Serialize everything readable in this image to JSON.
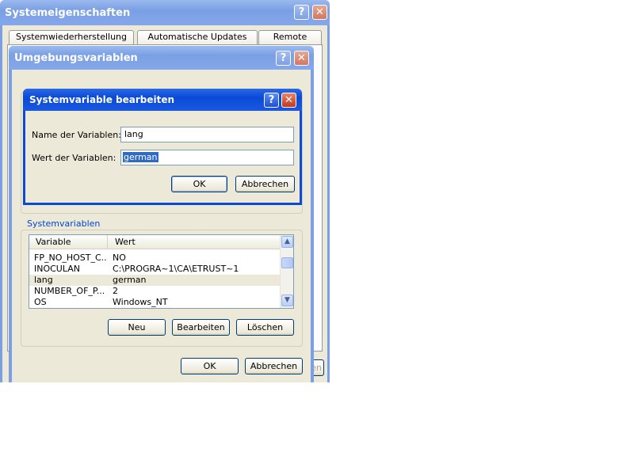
{
  "back_window": {
    "title": "Systemeigenschaften",
    "tabs": [
      "Systemwiederherstellung",
      "Automatische Updates",
      "Remote"
    ],
    "partial_button": "en"
  },
  "env_window": {
    "title": "Umgebungsvariablen",
    "system_group_label": "Systemvariablen",
    "list_headers": {
      "variable": "Variable",
      "value": "Wert"
    },
    "rows": [
      {
        "name": "FP_NO_HOST_C...",
        "value": "NO"
      },
      {
        "name": "INOCULAN",
        "value": "C:\\PROGRA~1\\CA\\ETRUST~1"
      },
      {
        "name": "lang",
        "value": "german"
      },
      {
        "name": "NUMBER_OF_P...",
        "value": "2"
      },
      {
        "name": "OS",
        "value": "Windows_NT"
      }
    ],
    "buttons": {
      "new": "Neu",
      "edit": "Bearbeiten",
      "delete": "Löschen",
      "ok": "OK",
      "cancel": "Abbrechen"
    }
  },
  "edit_dialog": {
    "title": "Systemvariable bearbeiten",
    "name_label": "Name der Variablen:",
    "name_value": "lang",
    "value_label": "Wert der Variablen:",
    "value_value": "german",
    "ok": "OK",
    "cancel": "Abbrechen"
  },
  "glyphs": {
    "help": "?",
    "close": "✕",
    "up": "▲",
    "down": "▼"
  },
  "colors": {
    "active_title": "#0a4ad6",
    "inactive_title": "#7a9fe4",
    "face": "#ece9d8",
    "selection": "#316ac5"
  }
}
